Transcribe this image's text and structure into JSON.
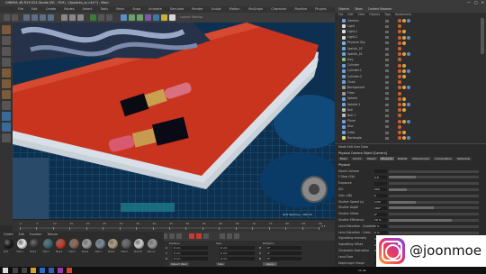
{
  "window": {
    "title": "CINEMA 4D R19.024 Studio (RC - R19) - [lipsticks_sc.c4d *] - Main",
    "controls": [
      "—",
      "□",
      "✕"
    ]
  },
  "menu": [
    "File",
    "Edit",
    "Create",
    "Modes",
    "Select",
    "Tools",
    "Mesh",
    "Snap",
    "Animate",
    "Simulate",
    "Render",
    "Sculpt",
    "Motion Tracker",
    "MoGraph",
    "Character",
    "Pipeline",
    "Plugins",
    "Script",
    "Window",
    "Help"
  ],
  "layout_label": "Layout: Startup",
  "object_manager": {
    "tabs": [
      "Objects",
      "Takes",
      "Content Browser"
    ],
    "menu": [
      "File",
      "Edit",
      "View",
      "Objects",
      "Tags",
      "Bookmarks"
    ],
    "rows": [
      {
        "name": "Camera",
        "icon_color": "#6fa0d8"
      },
      {
        "name": "Light",
        "icon_color": "#d9d9d9"
      },
      {
        "name": "Light.1",
        "icon_color": "#d9d9d9"
      },
      {
        "name": "Light.2",
        "icon_color": "#d9d9d9"
      },
      {
        "name": "Physical Sky",
        "icon_color": "#7ab0e0"
      },
      {
        "name": "lipstick_02",
        "icon_color": "#6fa0d8"
      },
      {
        "name": "lipstick_01",
        "icon_color": "#6fa0d8"
      },
      {
        "name": "tray",
        "icon_color": "#80c080"
      },
      {
        "name": "Cylinder",
        "icon_color": "#6fa0d8"
      },
      {
        "name": "Cylinder.1",
        "icon_color": "#6fa0d8"
      },
      {
        "name": "Cylinder.2",
        "icon_color": "#6fa0d8"
      },
      {
        "name": "Chain",
        "icon_color": "#6fa0d8"
      },
      {
        "name": "Background",
        "icon_color": "#9a9a9a"
      },
      {
        "name": "Floor",
        "icon_color": "#9a9a9a"
      },
      {
        "name": "Sphere",
        "icon_color": "#6fa0d8"
      },
      {
        "name": "Sphere.1",
        "icon_color": "#6fa0d8"
      },
      {
        "name": "Null",
        "icon_color": "#bbbbbb"
      },
      {
        "name": "Null.1",
        "icon_color": "#bbbbbb"
      },
      {
        "name": "Plane",
        "icon_color": "#6fa0d8"
      },
      {
        "name": "Disc",
        "icon_color": "#6fa0d8"
      },
      {
        "name": "Cube",
        "icon_color": "#6fa0d8"
      },
      {
        "name": "Rectangle",
        "icon_color": "#e0d070"
      }
    ]
  },
  "attributes": {
    "header": "Mode  Edit  User Data",
    "object_title": "Physical Camera Object [Camera]",
    "tabs": [
      "Basic",
      "Coord.",
      "Object",
      "Physical",
      "Details",
      "Stereoscopic",
      "Composition",
      "Spherical"
    ],
    "section": "Physical",
    "rows": [
      {
        "label": "Movie Camera",
        "value": ""
      },
      {
        "label": "F-Stop (f/#)",
        "value": "2.8"
      },
      {
        "label": "Exposure",
        "value": ""
      },
      {
        "label": "ISO",
        "value": "200"
      },
      {
        "label": "Gain (dB)",
        "value": "0"
      },
      {
        "label": "Shutter Speed (s)",
        "value": "1/30"
      },
      {
        "label": "Shutter Angle",
        "value": "180°"
      },
      {
        "label": "Shutter Offset",
        "value": "0°"
      },
      {
        "label": "Shutter Efficiency",
        "value": "70 %"
      },
      {
        "label": "Lens Distortion - Quadratic",
        "value": "0 %"
      },
      {
        "label": "Lens Distortion - Cubic",
        "value": "0 %"
      },
      {
        "label": "Vignetting Intensity",
        "value": "0 %"
      },
      {
        "label": "Vignetting Offset",
        "value": "0 %"
      },
      {
        "label": "Chromatic Aberration",
        "value": "0 %"
      },
      {
        "label": "Lens Flare",
        "value": ""
      },
      {
        "label": "Diaphragm Shape",
        "value": ""
      }
    ],
    "fills": [
      0,
      0.3,
      0,
      0.2,
      0,
      0.3,
      0.5,
      0,
      0.7,
      0,
      0,
      0,
      0,
      0,
      0,
      0
    ]
  },
  "viewport": {
    "camera_label": "Camera",
    "fps_label": "Grid Spacing : 100 cm"
  },
  "timeline": {
    "ticks": [
      "0",
      "5",
      "10",
      "15",
      "20",
      "25",
      "30",
      "35",
      "40",
      "45",
      "50",
      "55",
      "60",
      "65",
      "70",
      "75",
      "80",
      "85",
      "90"
    ],
    "frame_start": "0 F",
    "frame_end": "90 F",
    "current": "0 F"
  },
  "materials": {
    "menu": [
      "Create",
      "Edit",
      "Function",
      "Texture"
    ],
    "swatches": [
      {
        "name": "Mat",
        "color": "#1c1c1c"
      },
      {
        "name": "Mat.1",
        "color": "#e6e6e6"
      },
      {
        "name": "Mat.2",
        "color": "#3a3a3a"
      },
      {
        "name": "Mat.3",
        "color": "#3a6a70"
      },
      {
        "name": "Mat.4",
        "color": "#c83a2a"
      },
      {
        "name": "Mat.5",
        "color": "#8a6a50"
      },
      {
        "name": "Mat.6",
        "color": "#a0a0a0"
      },
      {
        "name": "Mat.7",
        "color": "#7a8a9a"
      },
      {
        "name": "Mat.8",
        "color": "#b0a080"
      },
      {
        "name": "Mat.9",
        "color": "#606060"
      },
      {
        "name": "Mat.10",
        "color": "#cfcfcf"
      },
      {
        "name": "Mat.11",
        "color": "#9a9a9a"
      }
    ]
  },
  "coordinates": {
    "headers": [
      "Position",
      "Size",
      "Rotation"
    ],
    "rows": [
      [
        "X",
        "0 cm",
        "0 cm",
        "H",
        "0°"
      ],
      [
        "Y",
        "0 cm",
        "0 cm",
        "P",
        "0°"
      ],
      [
        "Z",
        "0 cm",
        "0 cm",
        "B",
        "0°"
      ]
    ],
    "mode": "Object (Rel)",
    "size_mode": "Size",
    "apply": "Apply"
  },
  "taskbar": {
    "time": "11:42",
    "date": "2018-05-14"
  },
  "watermark": {
    "handle": "@joonmoe"
  }
}
